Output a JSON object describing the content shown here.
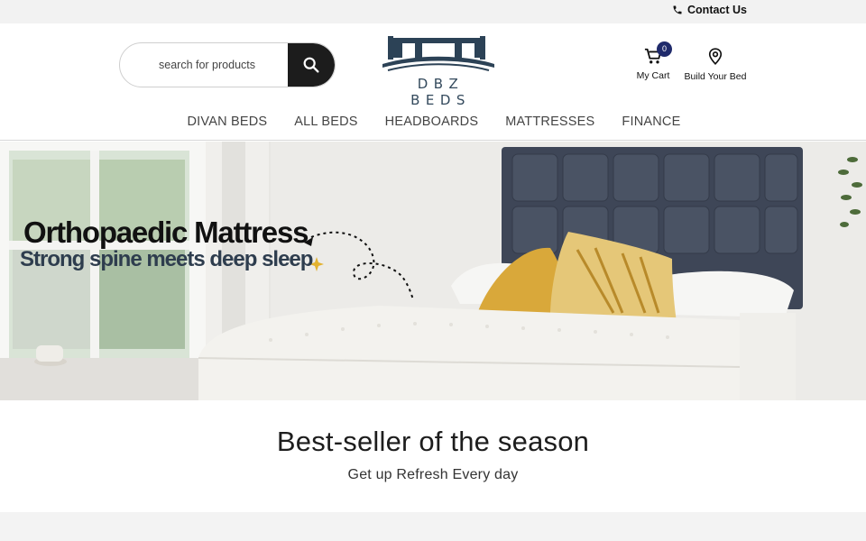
{
  "topbar": {
    "contact_label": "Contact Us",
    "icon": "phone-icon"
  },
  "search": {
    "placeholder": "search for products",
    "value": "",
    "icon": "search-icon"
  },
  "logo": {
    "text": "DBZ BEDS"
  },
  "header": {
    "cart_label": "My Cart",
    "cart_count": "0",
    "build_label": "Build Your Bed"
  },
  "nav": {
    "items": [
      {
        "label": "DIVAN BEDS"
      },
      {
        "label": "ALL BEDS"
      },
      {
        "label": "HEADBOARDS"
      },
      {
        "label": "MATTRESSES"
      },
      {
        "label": "FINANCE"
      }
    ]
  },
  "hero": {
    "title": "Orthopaedic Mattress",
    "subtitle": "Strong spine meets deep sleep"
  },
  "bestseller": {
    "title": "Best-seller of the season",
    "subtitle": "Get up Refresh Every day"
  },
  "colors": {
    "badge": "#1f2a6b",
    "search_button": "#1c1c1c",
    "logo": "#33495c",
    "headboard": "#3e4657"
  }
}
